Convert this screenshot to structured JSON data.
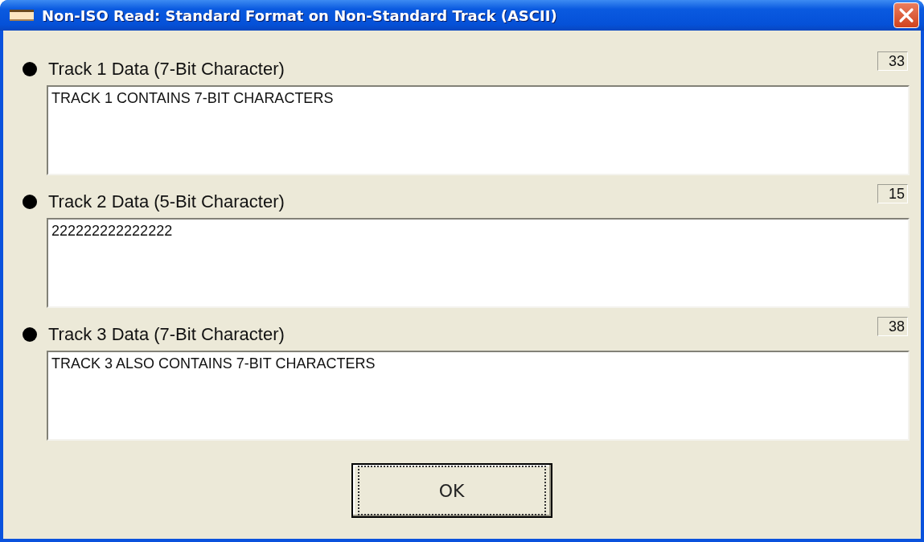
{
  "window": {
    "title": "Non-ISO Read: Standard Format on Non-Standard Track (ASCII)"
  },
  "tracks": [
    {
      "label": "Track 1 Data (7-Bit Character)",
      "count": "33",
      "value": "TRACK 1 CONTAINS 7-BIT CHARACTERS"
    },
    {
      "label": "Track 2 Data (5-Bit Character)",
      "count": "15",
      "value": "222222222222222"
    },
    {
      "label": "Track 3 Data (7-Bit Character)",
      "count": "38",
      "value": "TRACK 3 ALSO CONTAINS 7-BIT CHARACTERS"
    }
  ],
  "buttons": [
    {
      "label": "OK",
      "focused": true
    }
  ]
}
